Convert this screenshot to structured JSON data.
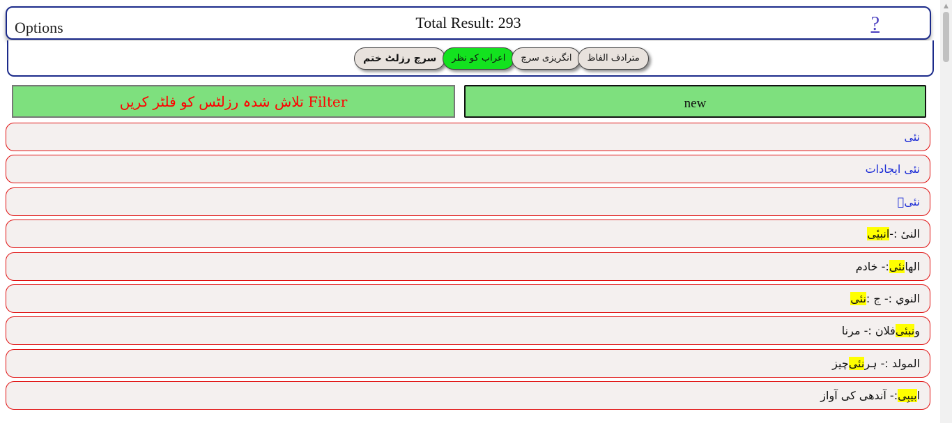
{
  "header": {
    "options_label": "Options",
    "total_result": "Total Result: 293",
    "help_label": "?"
  },
  "buttons": [
    {
      "label": "سرچ رزلٹ ختم",
      "style": "bold"
    },
    {
      "label": "اعراب کو نظر",
      "style": "active"
    },
    {
      "label": "انگریزی سرچ",
      "style": "normal"
    },
    {
      "label": "مترادف الفاظ",
      "style": "normal"
    }
  ],
  "filter": {
    "label": "تلاش شدہ رزلٹس کو فلٹر کریں Filter",
    "search_value": "new"
  },
  "results": [
    {
      "pre": "",
      "hl": "",
      "post": "نئی",
      "color": "blue"
    },
    {
      "pre": "",
      "hl": "",
      "post": "نئی ایجادات",
      "color": "blue"
    },
    {
      "pre": "",
      "hl": "",
      "post": "نئیؑ",
      "color": "blue"
    },
    {
      "pre": "النیٔ :- ",
      "hl": "انبیٔی",
      "post": "",
      "color": "black"
    },
    {
      "pre": "الھا ",
      "hl": "نئی",
      "post": ":- خادم",
      "color": "black"
    },
    {
      "pre": "النوي :- ج : ",
      "hl": "نئی",
      "post": "",
      "color": "black"
    },
    {
      "pre": "و",
      "hl": "نبئی",
      "post": " فلان :- مرنا",
      "color": "black"
    },
    {
      "pre": "المولد :- ہر ",
      "hl": "نئی",
      "post": " چیز",
      "color": "black"
    },
    {
      "pre": "ا",
      "hl": "بیبِی",
      "post": " :- آندھی کی آواز",
      "color": "black"
    }
  ],
  "colors": {
    "frame_border": "#1b2a8a",
    "row_border": "#e01010",
    "filter_bg": "#7ee07e",
    "active_button": "#13e21f",
    "highlight": "#ffff00",
    "link_blue": "#1a2bd6"
  }
}
